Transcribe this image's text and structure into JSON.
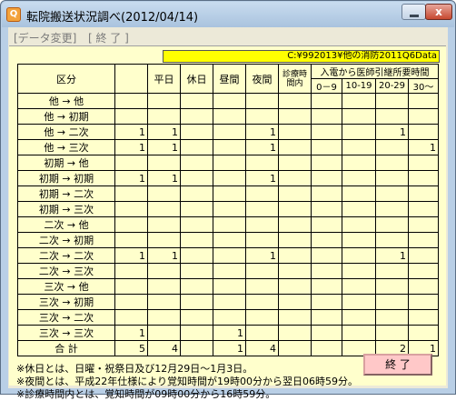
{
  "window": {
    "icon_text": "Q",
    "title": "転院搬送状況調べ(2012/04/14)",
    "minimize_glyph": "",
    "close_glyph": "x"
  },
  "menu": [
    {
      "label": "[データ変更]"
    },
    {
      "label": "[ 終  了 ]"
    }
  ],
  "path_label": "C:¥992013¥他の消防2011Q6Data",
  "table": {
    "headers": {
      "category": "区分",
      "weekday": "平日",
      "holiday": "休日",
      "daytime": "昼間",
      "night": "夜間",
      "clinic_hours": "診療時間内",
      "time_group": "入電から医師引継所要時間",
      "t0_9": "0－9",
      "t10_19": "10-19",
      "t20_29": "20-29",
      "t30": "30～"
    },
    "rows": [
      {
        "route": "他 → 他",
        "weekday": "",
        "holiday": "",
        "daytime": "",
        "night": "",
        "clinic": "",
        "t0_9": "",
        "t10_19": "",
        "t20_29": "",
        "t30": "",
        "total": ""
      },
      {
        "route": "他 → 初期",
        "weekday": "",
        "holiday": "",
        "daytime": "",
        "night": "",
        "clinic": "",
        "t0_9": "",
        "t10_19": "",
        "t20_29": "",
        "t30": "",
        "total": ""
      },
      {
        "route": "他 → 二次",
        "total": "1",
        "weekday": "1",
        "holiday": "",
        "daytime": "",
        "night": "1",
        "clinic": "",
        "t0_9": "",
        "t10_19": "",
        "t20_29": "1",
        "t30": ""
      },
      {
        "route": "他 → 三次",
        "total": "1",
        "weekday": "1",
        "holiday": "",
        "daytime": "",
        "night": "1",
        "clinic": "",
        "t0_9": "",
        "t10_19": "",
        "t20_29": "",
        "t30": "1"
      },
      {
        "route": "初期 → 他",
        "total": "",
        "weekday": "",
        "holiday": "",
        "daytime": "",
        "night": "",
        "clinic": "",
        "t0_9": "",
        "t10_19": "",
        "t20_29": "",
        "t30": ""
      },
      {
        "route": "初期 → 初期",
        "total": "1",
        "weekday": "1",
        "holiday": "",
        "daytime": "",
        "night": "1",
        "clinic": "",
        "t0_9": "",
        "t10_19": "",
        "t20_29": "",
        "t30": ""
      },
      {
        "route": "初期 → 二次",
        "total": "",
        "weekday": "",
        "holiday": "",
        "daytime": "",
        "night": "",
        "clinic": "",
        "t0_9": "",
        "t10_19": "",
        "t20_29": "",
        "t30": ""
      },
      {
        "route": "初期 → 三次",
        "total": "",
        "weekday": "",
        "holiday": "",
        "daytime": "",
        "night": "",
        "clinic": "",
        "t0_9": "",
        "t10_19": "",
        "t20_29": "",
        "t30": ""
      },
      {
        "route": "二次 → 他",
        "total": "",
        "weekday": "",
        "holiday": "",
        "daytime": "",
        "night": "",
        "clinic": "",
        "t0_9": "",
        "t10_19": "",
        "t20_29": "",
        "t30": ""
      },
      {
        "route": "二次 → 初期",
        "total": "",
        "weekday": "",
        "holiday": "",
        "daytime": "",
        "night": "",
        "clinic": "",
        "t0_9": "",
        "t10_19": "",
        "t20_29": "",
        "t30": ""
      },
      {
        "route": "二次 → 二次",
        "total": "1",
        "weekday": "1",
        "holiday": "",
        "daytime": "",
        "night": "1",
        "clinic": "",
        "t0_9": "",
        "t10_19": "",
        "t20_29": "1",
        "t30": ""
      },
      {
        "route": "二次 → 三次",
        "total": "",
        "weekday": "",
        "holiday": "",
        "daytime": "",
        "night": "",
        "clinic": "",
        "t0_9": "",
        "t10_19": "",
        "t20_29": "",
        "t30": ""
      },
      {
        "route": "三次 → 他",
        "total": "",
        "weekday": "",
        "holiday": "",
        "daytime": "",
        "night": "",
        "clinic": "",
        "t0_9": "",
        "t10_19": "",
        "t20_29": "",
        "t30": ""
      },
      {
        "route": "三次 → 初期",
        "total": "",
        "weekday": "",
        "holiday": "",
        "daytime": "",
        "night": "",
        "clinic": "",
        "t0_9": "",
        "t10_19": "",
        "t20_29": "",
        "t30": ""
      },
      {
        "route": "三次 → 二次",
        "total": "",
        "weekday": "",
        "holiday": "",
        "daytime": "",
        "night": "",
        "clinic": "",
        "t0_9": "",
        "t10_19": "",
        "t20_29": "",
        "t30": ""
      },
      {
        "route": "三次 → 三次",
        "total": "1",
        "weekday": "",
        "holiday": "",
        "daytime": "1",
        "night": "",
        "clinic": "",
        "t0_9": "",
        "t10_19": "",
        "t20_29": "",
        "t30": ""
      }
    ],
    "total_row": {
      "label": "合 計",
      "total": "5",
      "weekday": "4",
      "holiday": "",
      "daytime": "1",
      "night": "4",
      "clinic": "",
      "t0_9": "",
      "t10_19": "",
      "t20_29": "2",
      "t30": "1"
    }
  },
  "notes": [
    "※休日とは、日曜・祝祭日及び12月29日～1月3日。",
    "※夜間とは、平成22年仕様により覚知時間が19時00分から翌日06時59分。",
    "※診療時間内とは、覚知時間が09時00分から16時59分。"
  ],
  "end_button_label": "終 了"
}
